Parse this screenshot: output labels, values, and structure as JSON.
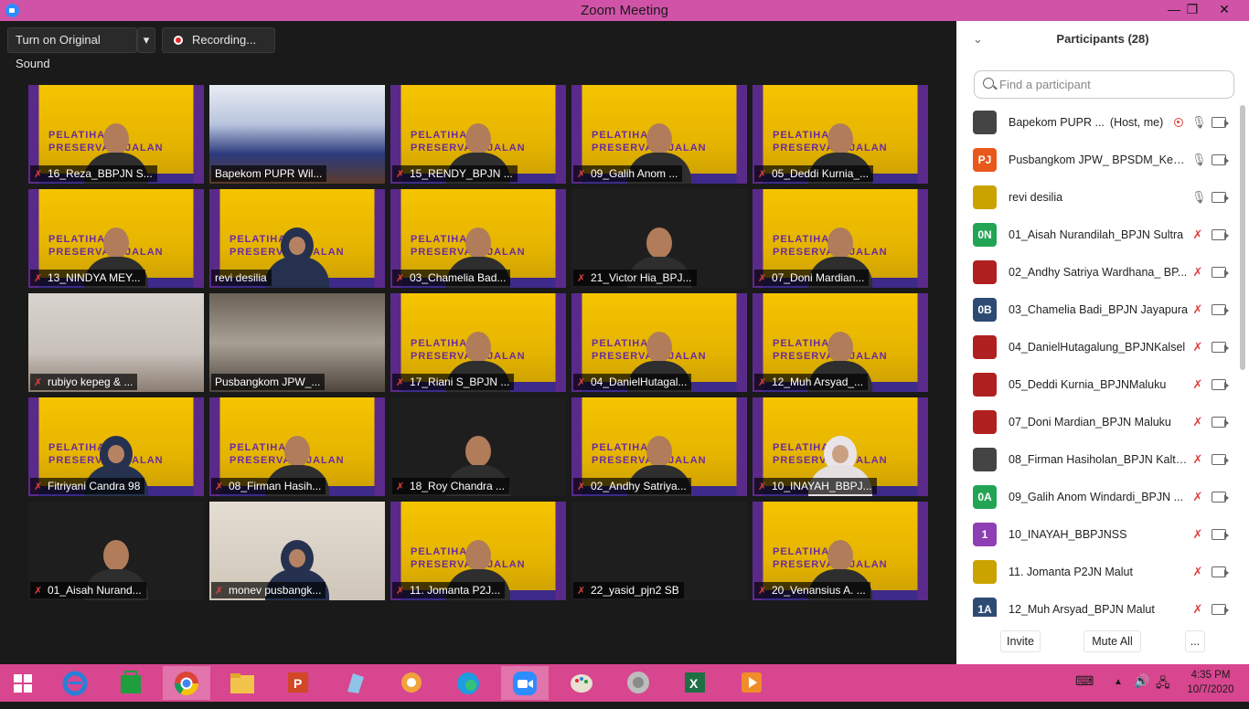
{
  "window": {
    "title": "Zoom Meeting",
    "minimize": "—",
    "maximize": "❐",
    "close": "✕"
  },
  "controls": {
    "original_sound": "Turn on Original Sound",
    "dropdown": "▾",
    "recording": "Recording..."
  },
  "tiles": [
    {
      "name": "16_Reza_BBPJN S...",
      "muted": true
    },
    {
      "name": "Bapekom PUPR Wil...",
      "muted": false
    },
    {
      "name": "15_RENDY_BPJN ...",
      "muted": true
    },
    {
      "name": "09_Galih Anom ...",
      "muted": true
    },
    {
      "name": "05_Deddi Kurnia_...",
      "muted": true
    },
    {
      "name": "13_NINDYA MEY...",
      "muted": true
    },
    {
      "name": "revi desilia",
      "muted": false
    },
    {
      "name": "03_Chamelia Bad...",
      "muted": true
    },
    {
      "name": "21_Victor Hia_BPJ...",
      "muted": true
    },
    {
      "name": "07_Doni Mardian...",
      "muted": true
    },
    {
      "name": "rubiyo kepeg & ...",
      "muted": true
    },
    {
      "name": "Pusbangkom JPW_...",
      "muted": false
    },
    {
      "name": "17_Riani S_BPJN ...",
      "muted": true
    },
    {
      "name": "04_DanielHutagal...",
      "muted": true
    },
    {
      "name": "12_Muh Arsyad_...",
      "muted": true
    },
    {
      "name": "Fitriyani Candra 98",
      "muted": true
    },
    {
      "name": "08_Firman Hasih...",
      "muted": true
    },
    {
      "name": "18_Roy Chandra ...",
      "muted": true
    },
    {
      "name": "02_Andhy Satriya...",
      "muted": true
    },
    {
      "name": "10_INAYAH_BBPJ...",
      "muted": true
    },
    {
      "name": "01_Aisah Nurand...",
      "muted": true
    },
    {
      "name": "monev pusbangk...",
      "muted": true
    },
    {
      "name": "11. Jomanta P2J...",
      "muted": true
    },
    {
      "name": "22_yasid_pjn2 SB",
      "muted": true
    },
    {
      "name": "20_Venansius A. ...",
      "muted": true
    }
  ],
  "participants_panel": {
    "title": "Participants (28)",
    "search_placeholder": "Find a participant",
    "items": [
      {
        "avatar": "",
        "name": "Bapekom PUPR ...",
        "tag": "(Host, me)",
        "mic": "on",
        "avatar_color": "#444"
      },
      {
        "avatar": "PJ",
        "name": "Pusbangkom JPW_ BPSDM_Kem...",
        "mic": "on",
        "avatar_color": "#e8581b"
      },
      {
        "avatar": "",
        "name": "revi desilia",
        "mic": "on",
        "avatar_color": "#caa300"
      },
      {
        "avatar": "0N",
        "name": "01_Aisah Nurandilah_BPJN Sultra",
        "mic": "muted",
        "avatar_color": "#23a455"
      },
      {
        "avatar": "",
        "name": "02_Andhy Satriya Wardhana_ BP...",
        "mic": "muted",
        "avatar_color": "#b12020"
      },
      {
        "avatar": "0B",
        "name": "03_Chamelia Badi_BPJN Jayapura",
        "mic": "muted",
        "avatar_color": "#2d4a73"
      },
      {
        "avatar": "",
        "name": "04_DanielHutagalung_BPJNKalsel",
        "mic": "muted",
        "avatar_color": "#b12020"
      },
      {
        "avatar": "",
        "name": "05_Deddi Kurnia_BPJNMaluku",
        "mic": "muted",
        "avatar_color": "#b12020"
      },
      {
        "avatar": "",
        "name": "07_Doni Mardian_BPJN Maluku",
        "mic": "muted",
        "avatar_color": "#b12020"
      },
      {
        "avatar": "",
        "name": "08_Firman Hasiholan_BPJN Kalte...",
        "mic": "muted",
        "avatar_color": "#444"
      },
      {
        "avatar": "0A",
        "name": "09_Galih Anom Windardi_BPJN ...",
        "mic": "muted",
        "avatar_color": "#23a455"
      },
      {
        "avatar": "1",
        "name": "10_INAYAH_BBPJNSS",
        "mic": "muted",
        "avatar_color": "#8e3fb4"
      },
      {
        "avatar": "",
        "name": "11. Jomanta P2JN Malut",
        "mic": "muted",
        "avatar_color": "#caa300"
      },
      {
        "avatar": "1A",
        "name": "12_Muh Arsyad_BPJN Malut",
        "mic": "muted",
        "avatar_color": "#2d4a73"
      }
    ],
    "invite": "Invite",
    "mute_all": "Mute All",
    "more": "..."
  },
  "taskbar": {
    "clock_time": "4:35 PM",
    "clock_date": "10/7/2020"
  }
}
